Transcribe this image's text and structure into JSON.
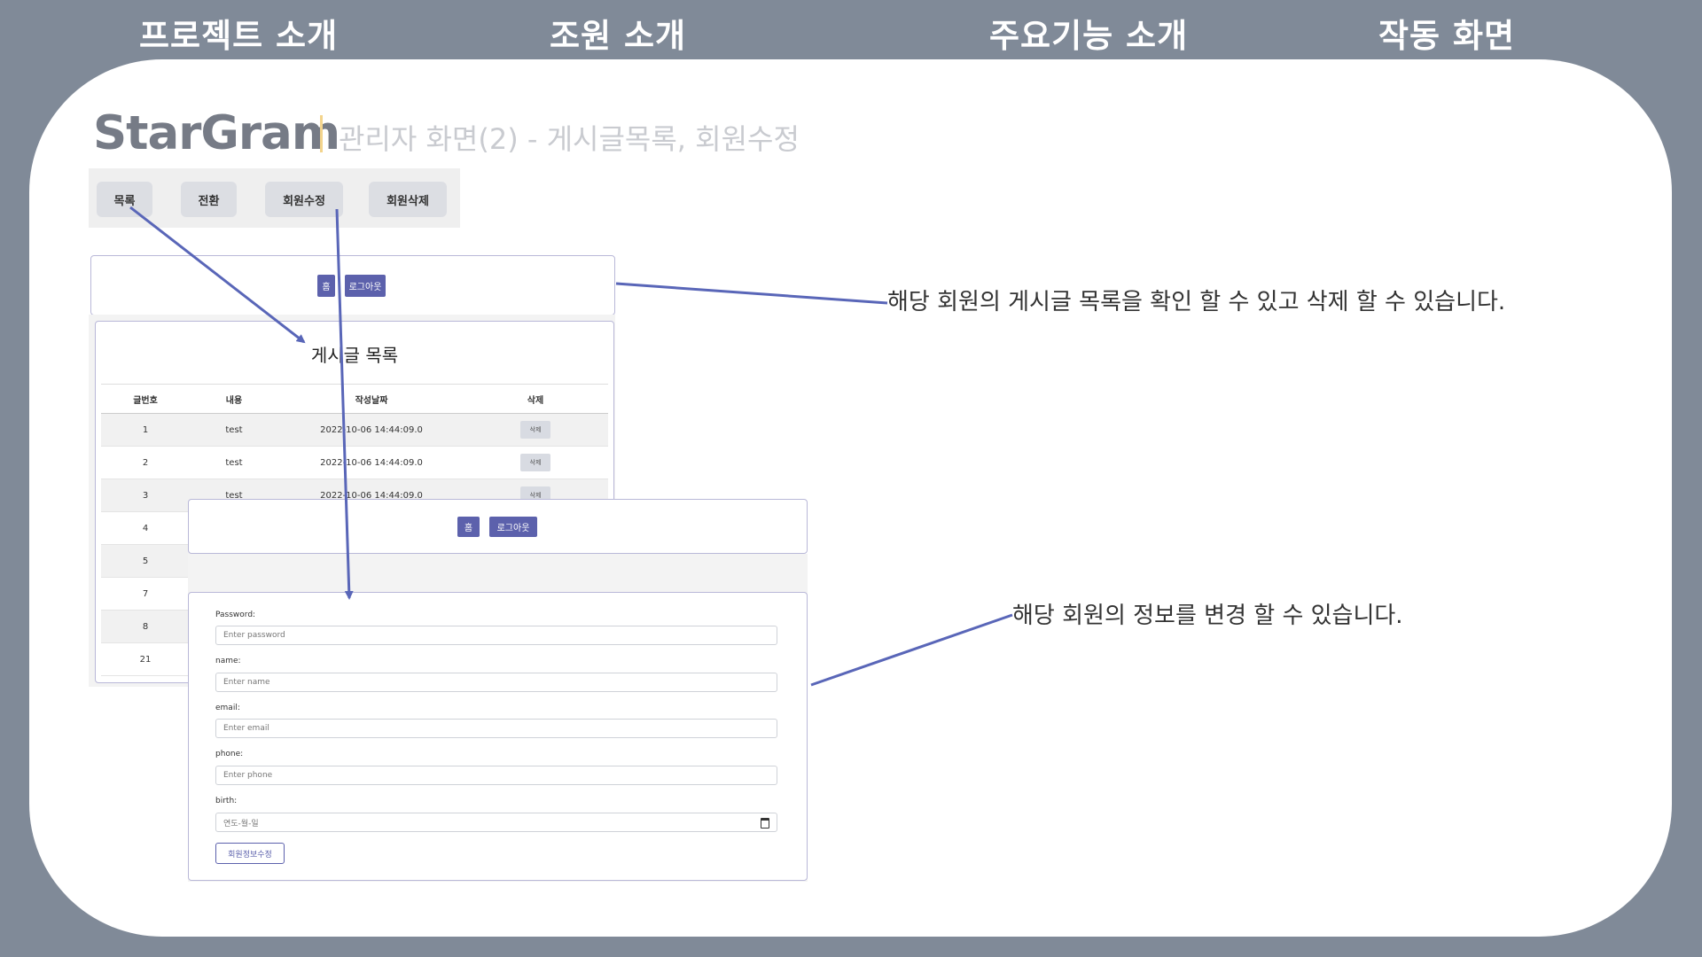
{
  "nav": {
    "items": [
      {
        "label": "프로젝트 소개"
      },
      {
        "label": "조원 소개"
      },
      {
        "label": "주요기능 소개"
      },
      {
        "label": "작동 화면"
      }
    ]
  },
  "slide": {
    "brand": "StarGram",
    "subtitle": "관리자 화면(2) - 게시글목록, 회원수정"
  },
  "admin_toolbar": {
    "buttons": [
      "목록",
      "전환",
      "회원수정",
      "회원삭제"
    ]
  },
  "post_list_panel": {
    "home_label": "홈",
    "logout_label": "로그아웃",
    "title": "게시글 목록",
    "columns": [
      "글번호",
      "내용",
      "작성날짜",
      "삭제"
    ],
    "rows": [
      {
        "no": "1",
        "content": "test",
        "date": "2022-10-06 14:44:09.0",
        "delete": "삭제"
      },
      {
        "no": "2",
        "content": "test",
        "date": "2022-10-06 14:44:09.0",
        "delete": "삭제"
      },
      {
        "no": "3",
        "content": "test",
        "date": "2022-10-06 14:44:09.0",
        "delete": "삭제"
      },
      {
        "no": "4"
      },
      {
        "no": "5"
      },
      {
        "no": "7"
      },
      {
        "no": "8"
      },
      {
        "no": "21"
      }
    ]
  },
  "member_edit_panel": {
    "home_label": "홈",
    "logout_label": "로그아웃",
    "fields": [
      {
        "label": "Password:",
        "placeholder": "Enter password"
      },
      {
        "label": "name:",
        "placeholder": "Enter name"
      },
      {
        "label": "email:",
        "placeholder": "Enter email"
      },
      {
        "label": "phone:",
        "placeholder": "Enter phone"
      },
      {
        "label": "birth:",
        "placeholder": "연도-월-일"
      }
    ],
    "submit_label": "회원정보수정"
  },
  "annotations": {
    "post_list_note": "해당 회원의 게시글 목록을 확인 할 수 있고 삭제 할 수 있습니다.",
    "member_edit_note": "해당 회원의 정보를 변경 할 수 있습니다."
  },
  "colors": {
    "background": "#808a98",
    "accent": "#5c61ac",
    "arrow": "#5966b8",
    "brand_bar": "#f3d48c"
  }
}
